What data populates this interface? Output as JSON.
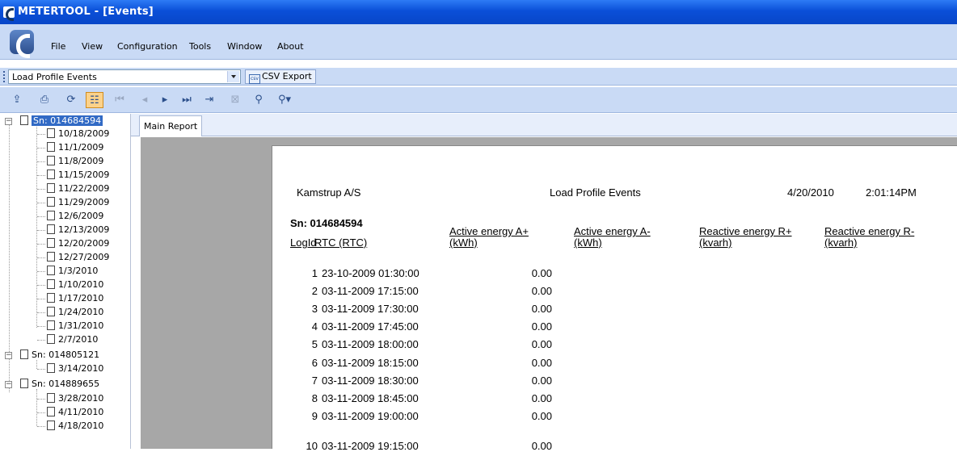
{
  "window": {
    "title": "METERTOOL - [Events]"
  },
  "menu": [
    "File",
    "View",
    "Configuration",
    "Tools",
    "Window",
    "About"
  ],
  "toolbar": {
    "report_select": "Load Profile Events",
    "csv_icon_text": "csv",
    "csv_export_label": "CSV Export",
    "icons": [
      "export-icon",
      "print-icon",
      "refresh-icon",
      "group-tree-icon",
      "first-page-icon",
      "previous-page-icon",
      "next-page-icon",
      "last-page-icon",
      "goto-page-icon",
      "stop-icon",
      "search-icon",
      "zoom-icon"
    ]
  },
  "tree": {
    "meters": [
      {
        "label": "Sn: 014684594",
        "selected": true,
        "dates": [
          "10/18/2009",
          "11/1/2009",
          "11/8/2009",
          "11/15/2009",
          "11/22/2009",
          "11/29/2009",
          "12/6/2009",
          "12/13/2009",
          "12/20/2009",
          "12/27/2009",
          "1/3/2010",
          "1/10/2010",
          "1/17/2010",
          "1/24/2010",
          "1/31/2010",
          "2/7/2010"
        ]
      },
      {
        "label": "Sn: 014805121",
        "selected": false,
        "dates": [
          "3/14/2010"
        ]
      },
      {
        "label": "Sn: 014889655",
        "selected": false,
        "dates": [
          "3/28/2010",
          "4/11/2010",
          "4/18/2010"
        ]
      }
    ]
  },
  "tabs": {
    "main_report": "Main Report"
  },
  "report": {
    "company": "Kamstrup A/S",
    "title": "Load Profile Events",
    "date": "4/20/2010",
    "time": "2:01:14PM",
    "serial": "Sn: 014684594",
    "columns": {
      "logid": "LogId",
      "rtc": "RTC (RTC)",
      "active_plus": "Active energy A+",
      "active_plus_unit": "(kWh)",
      "active_minus": "Active energy A-",
      "active_minus_unit": "(kWh)",
      "reactive_plus": "Reactive energy R+",
      "reactive_plus_unit": "(kvarh)",
      "reactive_minus": "Reactive energy R-",
      "reactive_minus_unit": "(kvarh)"
    },
    "rows": [
      {
        "id": "1",
        "rtc": "23-10-2009 01:30:00",
        "a_plus": "0.00"
      },
      {
        "id": "2",
        "rtc": "03-11-2009 17:15:00",
        "a_plus": "0.00"
      },
      {
        "id": "3",
        "rtc": "03-11-2009 17:30:00",
        "a_plus": "0.00"
      },
      {
        "id": "4",
        "rtc": "03-11-2009 17:45:00",
        "a_plus": "0.00"
      },
      {
        "id": "5",
        "rtc": "03-11-2009 18:00:00",
        "a_plus": "0.00"
      },
      {
        "id": "6",
        "rtc": "03-11-2009 18:15:00",
        "a_plus": "0.00"
      },
      {
        "id": "7",
        "rtc": "03-11-2009 18:30:00",
        "a_plus": "0.00"
      },
      {
        "id": "8",
        "rtc": "03-11-2009 18:45:00",
        "a_plus": "0.00"
      },
      {
        "id": "9",
        "rtc": "03-11-2009 19:00:00",
        "a_plus": "0.00"
      },
      {
        "id": "10",
        "rtc": "03-11-2009 19:15:00",
        "a_plus": "0.00"
      }
    ]
  }
}
